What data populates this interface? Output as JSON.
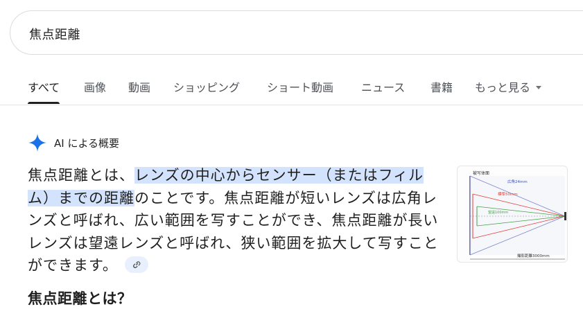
{
  "search": {
    "query": "焦点距離"
  },
  "tabs": [
    {
      "label": "すべて",
      "active": true
    },
    {
      "label": "画像"
    },
    {
      "label": "動画"
    },
    {
      "label": "ショッピング"
    },
    {
      "label": "ショート動画"
    },
    {
      "label": "ニュース"
    },
    {
      "label": "書籍"
    },
    {
      "label": "もっと見る"
    }
  ],
  "ai_overview": {
    "label": "AI による概要",
    "icon": "sparkle-icon",
    "accent": "#1a73e8",
    "highlight_color": "#d3e3fd",
    "text_pre": "焦点距離とは、",
    "text_highlight_1": "レンズの中心からセンサー（またはフィ",
    "text_highlight_2": "ルム）までの距離",
    "text_post": "のことです。焦点距離が短いレンズは広角レンズと呼ばれ、広い範囲を写すことができ、焦点距離が長いレンズは望遠レンズと呼ばれ、狭い範囲を拡大して写すことができます。",
    "link_icon": "link-icon"
  },
  "section_heading": "焦点距離とは？",
  "thumbnail": {
    "labels": {
      "subject": "被写体面",
      "wide": "広角24mm",
      "standard": "標準50mm",
      "tele": "望遠100mm",
      "distance": "撮影距離3000mm",
      "lens": "レンズ"
    }
  }
}
